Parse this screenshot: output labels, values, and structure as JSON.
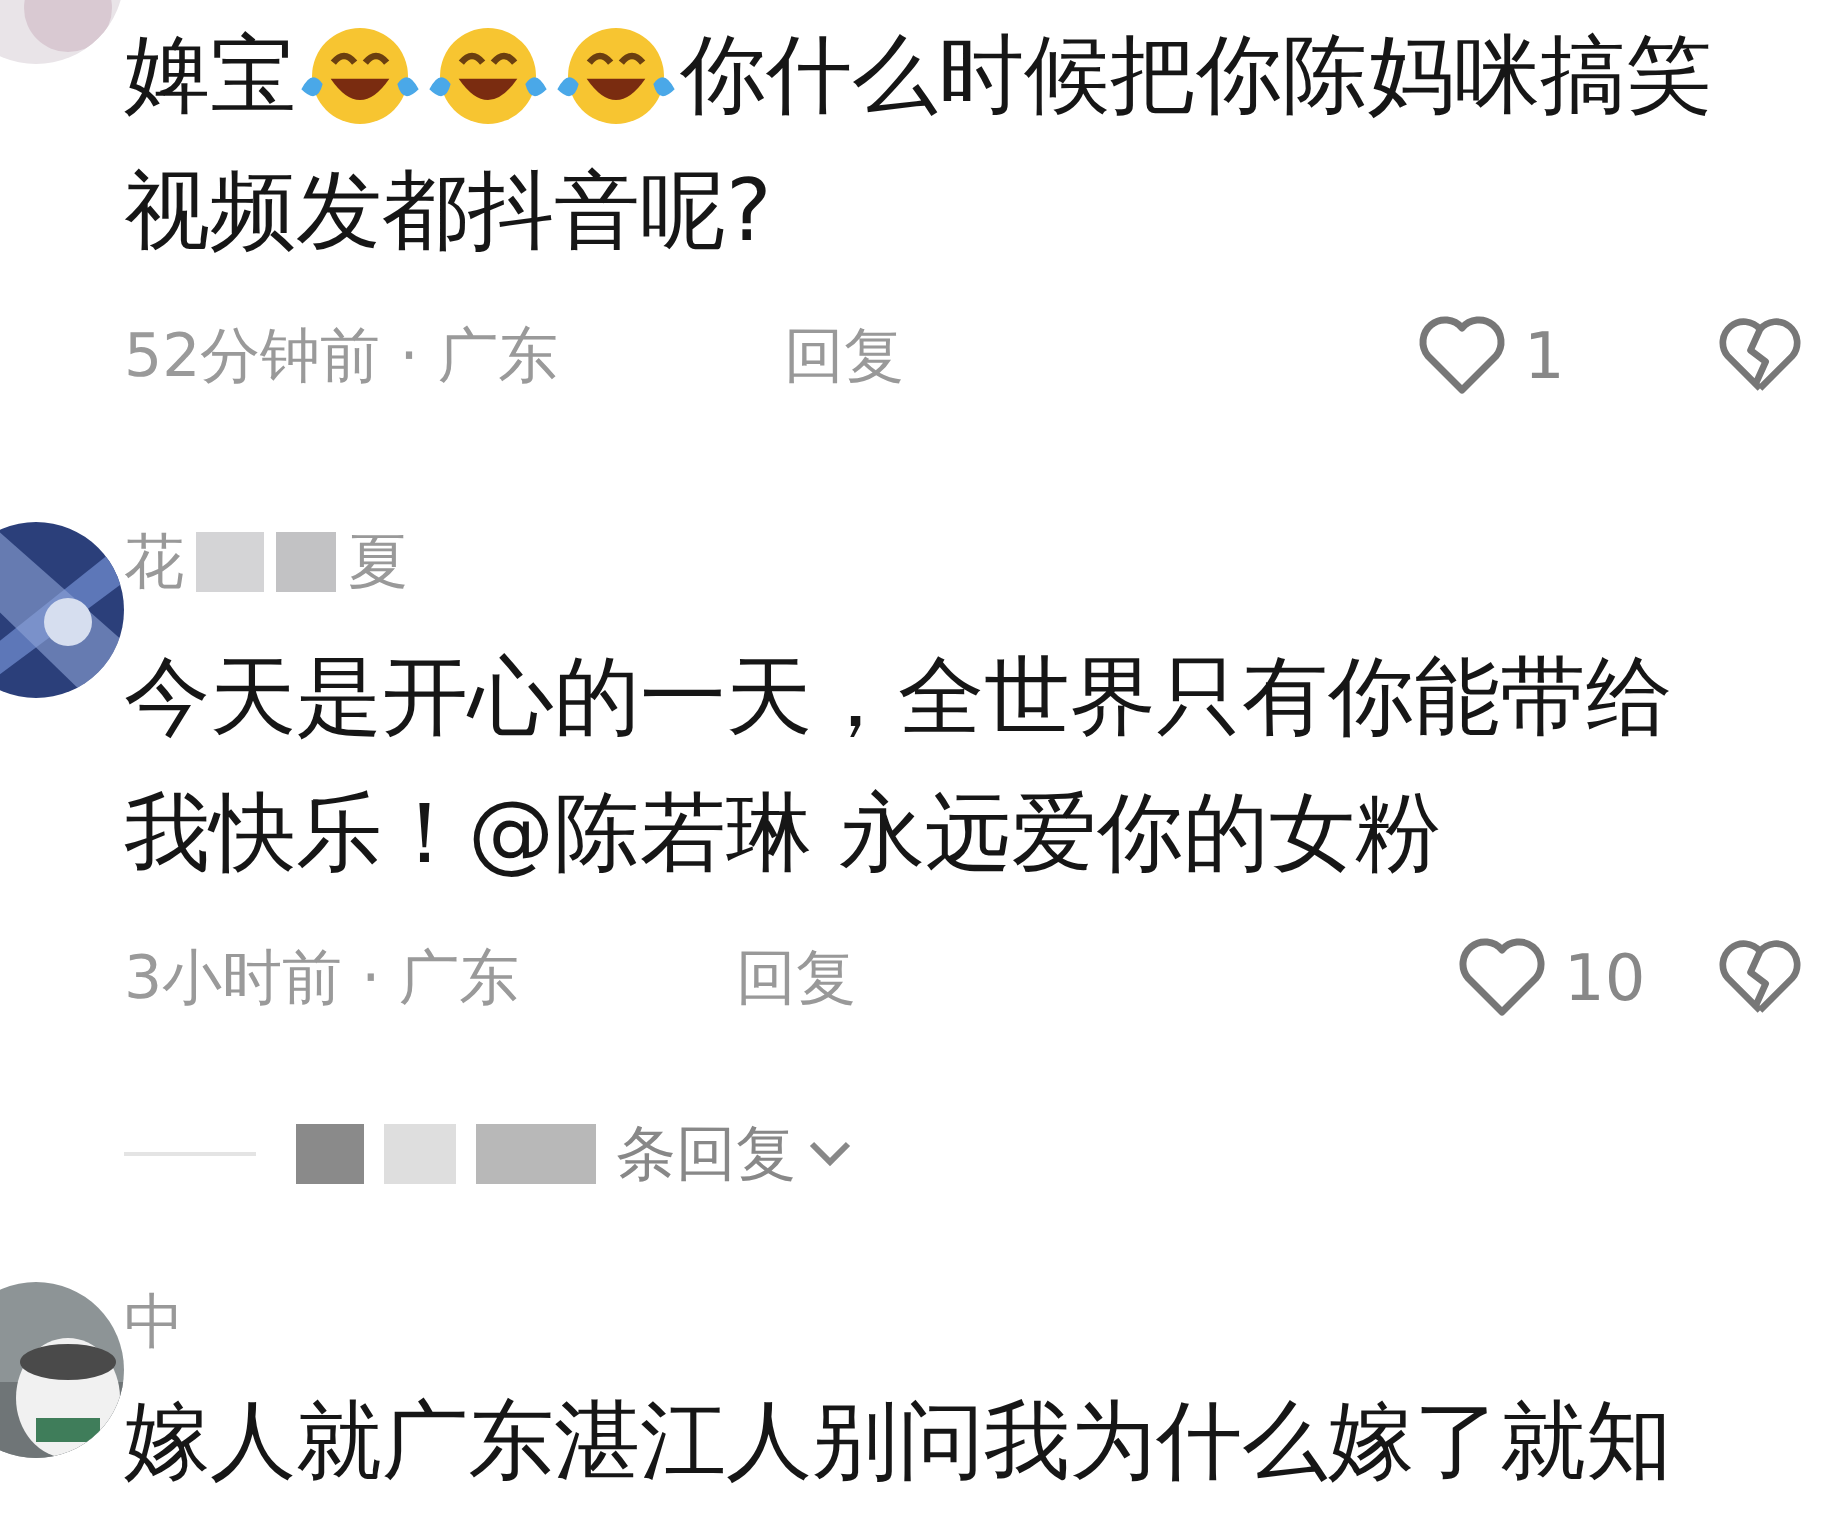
{
  "comments": [
    {
      "avatar": {
        "kind": "picture"
      },
      "lines": [
        [
          {
            "kind": "text",
            "text": "婢宝"
          },
          {
            "kind": "emoji"
          },
          {
            "kind": "emoji"
          },
          {
            "kind": "emoji"
          },
          {
            "kind": "text",
            "text": "你什么时候把你陈妈咪搞笑"
          }
        ],
        [
          {
            "kind": "text",
            "text": "视频发都抖音呢?"
          }
        ]
      ],
      "time": "52分钟前 · 广东",
      "reply": "回复",
      "likes": "1",
      "liked": false
    },
    {
      "avatar": {
        "kind": "picture"
      },
      "name_parts": [
        "花",
        "夏"
      ],
      "lines": [
        [
          {
            "kind": "text",
            "text": "今天是开心的一天，全世界只有你能带给"
          }
        ],
        [
          {
            "kind": "text",
            "text": "我快乐！@陈若琳 永远爱你的女粉"
          }
        ]
      ],
      "time": "3小时前 · 广东",
      "reply": "回复",
      "likes": "10",
      "liked": false,
      "replies_label": "条回复"
    },
    {
      "avatar": {
        "kind": "picture"
      },
      "name_parts": [
        "中"
      ],
      "lines": [
        [
          {
            "kind": "text",
            "text": "嫁人就广东湛江人别问我为什么嫁了就知"
          }
        ]
      ]
    }
  ]
}
